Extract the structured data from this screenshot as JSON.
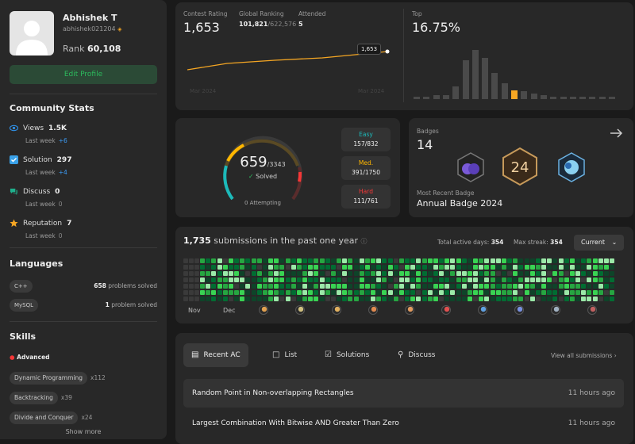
{
  "profile": {
    "name": "Abhishek T",
    "handle": "abhishek021204",
    "rank_label": "Rank",
    "rank_value": "60,108",
    "edit_label": "Edit Profile"
  },
  "community": {
    "title": "Community Stats",
    "items": [
      {
        "label": "Views",
        "value": "1.5K",
        "sub": "Last week",
        "delta": "+6",
        "delta_color": "#3c9cf6",
        "icon_color": "#2f8de0",
        "icon": "eye-icon"
      },
      {
        "label": "Solution",
        "value": "297",
        "sub": "Last week",
        "delta": "+4",
        "delta_color": "#3c9cf6",
        "icon_color": "#3aa1e8",
        "icon": "check-square-icon"
      },
      {
        "label": "Discuss",
        "value": "0",
        "sub": "Last week",
        "delta": "0",
        "delta_color": "#888",
        "icon_color": "#1fb08c",
        "icon": "chat-icon"
      },
      {
        "label": "Reputation",
        "value": "7",
        "sub": "Last week",
        "delta": "0",
        "delta_color": "#888",
        "icon_color": "#f5a623",
        "icon": "star-icon"
      }
    ]
  },
  "languages": {
    "title": "Languages",
    "items": [
      {
        "name": "C++",
        "count": "658",
        "suffix": "problems solved"
      },
      {
        "name": "MySQL",
        "count": "1",
        "suffix": "problem solved"
      }
    ]
  },
  "skills": {
    "title": "Skills",
    "level": "Advanced",
    "items": [
      {
        "name": "Dynamic Programming",
        "count": "x112"
      },
      {
        "name": "Backtracking",
        "count": "x39"
      },
      {
        "name": "Divide and Conquer",
        "count": "x24"
      }
    ],
    "show_more": "Show more"
  },
  "contest": {
    "rating_label": "Contest Rating",
    "rating": "1,653",
    "global_label": "Global Ranking",
    "global_rank": "101,821",
    "global_total": "/622,576",
    "attended_label": "Attended",
    "attended": "5",
    "tooltip": "1,653",
    "x_start": "Mar 2024",
    "x_end": "Mar 2024",
    "top_label": "Top",
    "top_value": "16.75%",
    "histogram": [
      2,
      2,
      3,
      3,
      10,
      30,
      38,
      32,
      20,
      12,
      7,
      6,
      4,
      3,
      2,
      2,
      2,
      2,
      2,
      2,
      2
    ],
    "highlight_index": 10,
    "line_color": "#f5a623"
  },
  "solved": {
    "count": "659",
    "total": "/3343",
    "solved_label": "Solved",
    "attempting": "0 Attempting",
    "easy_label": "Easy",
    "easy": "157/832",
    "easy_color": "#1cbaba",
    "med_label": "Med.",
    "med": "391/1750",
    "med_color": "#ffb700",
    "hard_label": "Hard",
    "hard": "111/761",
    "hard_color": "#f63737",
    "easy_frac": 0.189,
    "med_frac": 0.223,
    "hard_frac": 0.146
  },
  "badges": {
    "label": "Badges",
    "count": "14",
    "recent_label": "Most Recent Badge",
    "recent": "Annual Badge 2024"
  },
  "submissions": {
    "count": "1,735",
    "text": "submissions in the past one year",
    "active_label": "Total active days:",
    "active": "354",
    "streak_label": "Max streak:",
    "streak": "354",
    "dropdown": "Current",
    "months": [
      "Nov",
      "Dec"
    ]
  },
  "recent": {
    "tabs": [
      "Recent AC",
      "List",
      "Solutions",
      "Discuss"
    ],
    "view_all": "View all submissions",
    "items": [
      {
        "title": "Random Point in Non-overlapping Rectangles",
        "ago": "11 hours ago"
      },
      {
        "title": "Largest Combination With Bitwise AND Greater Than Zero",
        "ago": "11 hours ago"
      }
    ]
  }
}
